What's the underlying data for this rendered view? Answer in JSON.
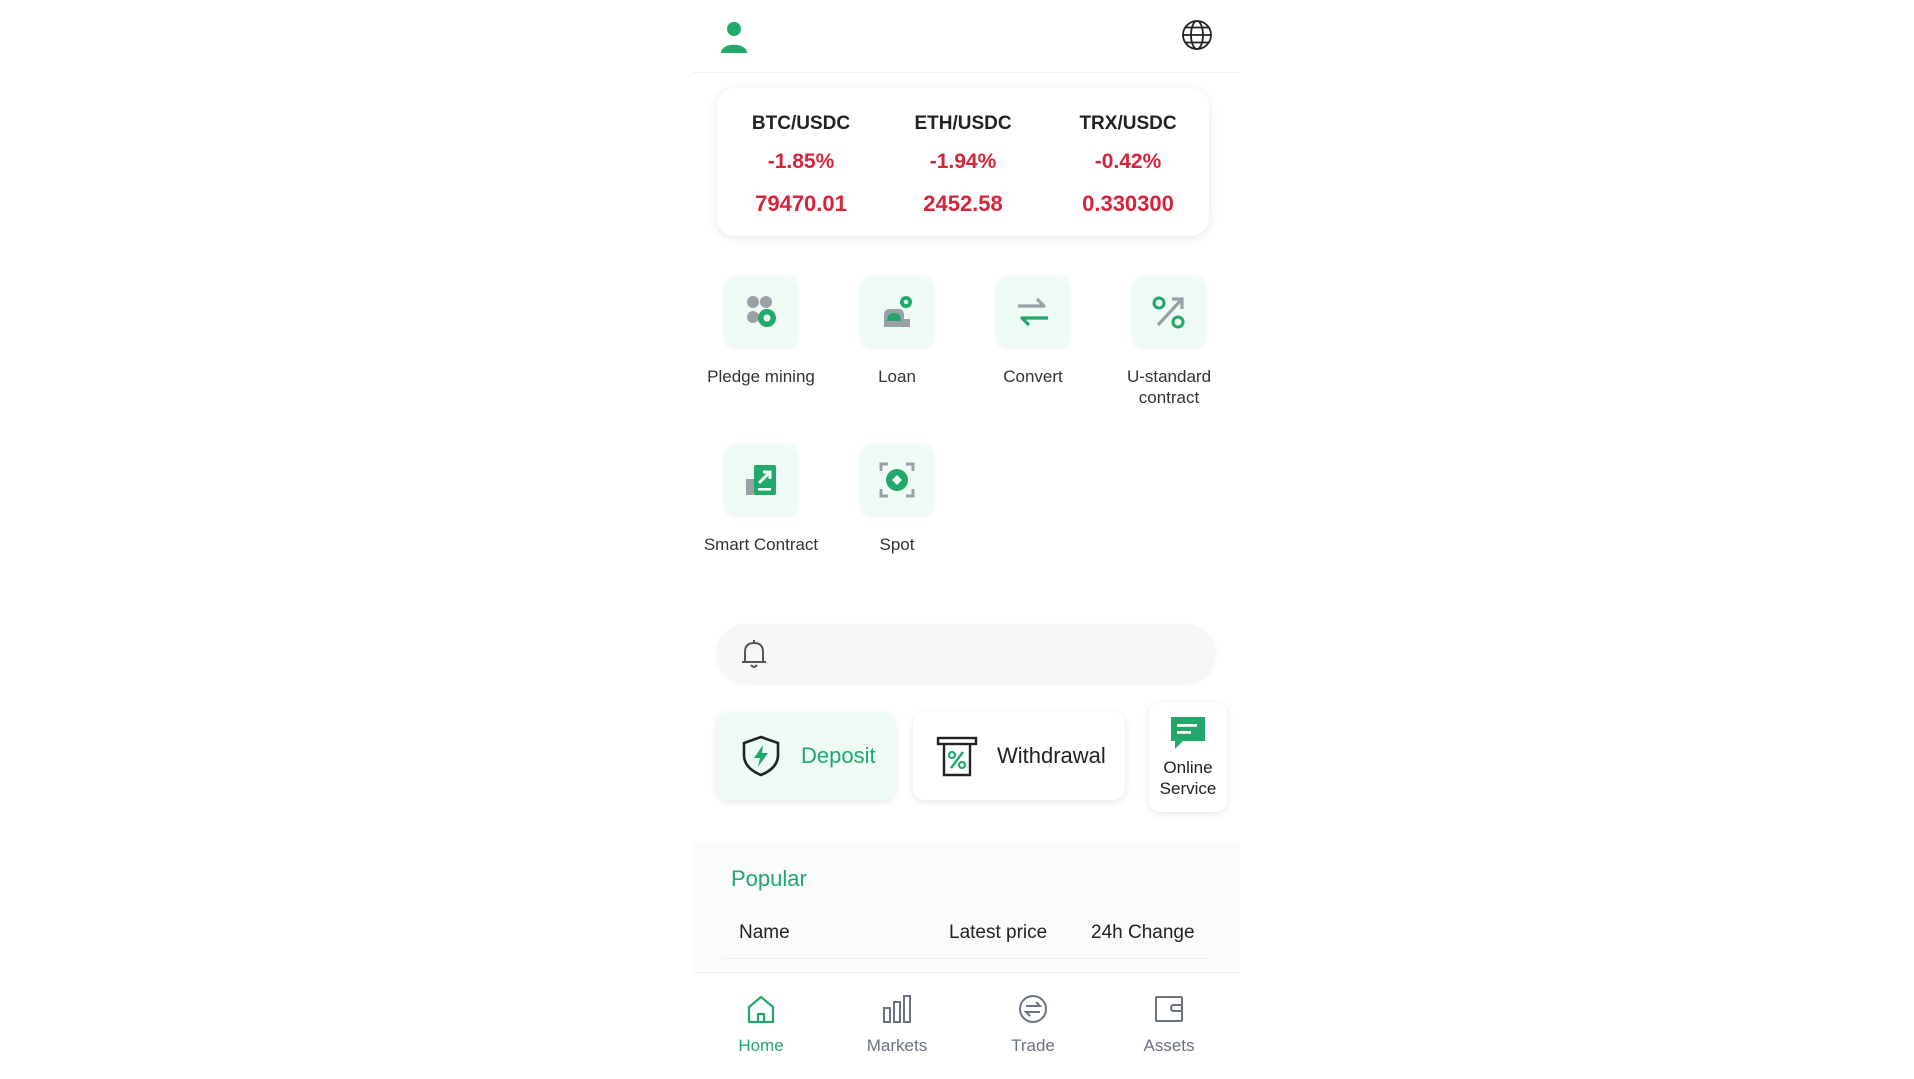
{
  "header": {
    "user_icon": "user-icon",
    "language_icon": "globe-icon"
  },
  "tickers": [
    {
      "pair": "BTC/USDC",
      "change": "-1.85%",
      "price": "79470.01"
    },
    {
      "pair": "ETH/USDC",
      "change": "-1.94%",
      "price": "2452.58"
    },
    {
      "pair": "TRX/USDC",
      "change": "-0.42%",
      "price": "0.330300"
    }
  ],
  "features": [
    {
      "label": "Pledge mining",
      "icon": "coins-icon"
    },
    {
      "label": "Loan",
      "icon": "loan-icon"
    },
    {
      "label": "Convert",
      "icon": "swap-arrows-icon"
    },
    {
      "label": "U-standard contract",
      "icon": "percent-arrow-icon"
    },
    {
      "label": "Smart Contract",
      "icon": "contract-chart-icon"
    },
    {
      "label": "Spot",
      "icon": "target-icon"
    }
  ],
  "notice": {
    "icon": "bell-icon"
  },
  "actions": {
    "deposit": "Deposit",
    "withdrawal": "Withdrawal",
    "online_service": "Online Service"
  },
  "popular": {
    "title": "Popular",
    "columns": [
      "Name",
      "Latest price",
      "24h Change"
    ]
  },
  "tabs": [
    {
      "label": "Home",
      "icon": "home-icon",
      "active": true
    },
    {
      "label": "Markets",
      "icon": "bar-chart-icon",
      "active": false
    },
    {
      "label": "Trade",
      "icon": "exchange-icon",
      "active": false
    },
    {
      "label": "Assets",
      "icon": "wallet-icon",
      "active": false
    }
  ],
  "colors": {
    "accent": "#23a86c",
    "negative": "#d6243c",
    "tile_bg": "#edfbf4"
  }
}
